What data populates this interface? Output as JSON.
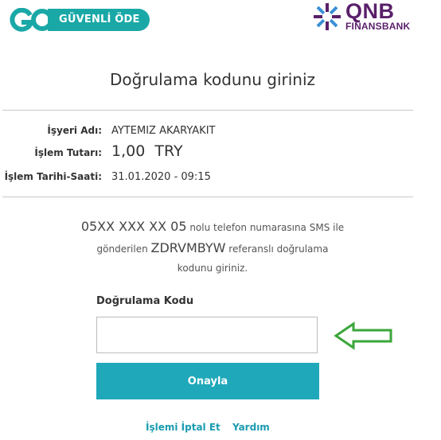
{
  "header": {
    "go_logo_text": "GÜVENLİ ÖDE",
    "bank_name": "QNB",
    "bank_subname": "FINANSBANK"
  },
  "title": "Doğrulama kodunu giriniz",
  "transaction": {
    "merchant_label": "İşyeri Adı:",
    "merchant_value": "AYTEMIZ AKARYAKIT",
    "amount_label": "İşlem Tutarı:",
    "amount_value": "1,00  TRY",
    "datetime_label": "İşlem Tarihi-Saati:",
    "datetime_value": "31.01.2020 - 09:15"
  },
  "message": {
    "phone": "05XX XXX XX 05",
    "line1_suffix": " nolu telefon numarasına SMS ile",
    "line2_prefix": "gönderilen ",
    "reference": "ZDRVMBYW",
    "line2_suffix": " referanslı doğrulama",
    "line3": "kodunu giriniz."
  },
  "form": {
    "code_label": "Doğrulama Kodu",
    "code_value": "",
    "submit_label": "Onayla"
  },
  "links": {
    "cancel": "İşlemi İptal Et",
    "help": "Yardım"
  },
  "colors": {
    "teal": "#1aa8a7",
    "button": "#1fa8ba",
    "arrow": "#3aa63a",
    "bank_purple": "#5a1f6a"
  }
}
